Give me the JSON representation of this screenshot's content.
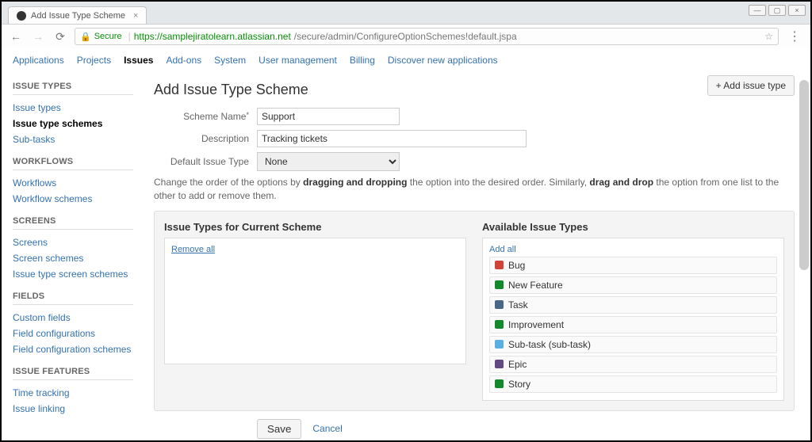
{
  "browser": {
    "tab_title": "Add Issue Type Scheme",
    "secure_label": "Secure",
    "url_host": "https://samplejiratolearn.atlassian.net",
    "url_path": "/secure/admin/ConfigureOptionSchemes!default.jspa"
  },
  "topnav": {
    "items": [
      "Applications",
      "Projects",
      "Issues",
      "Add-ons",
      "System",
      "User management",
      "Billing",
      "Discover new applications"
    ],
    "active": "Issues"
  },
  "sidebar": {
    "sections": [
      {
        "title": "ISSUE TYPES",
        "links": [
          "Issue types",
          "Issue type schemes",
          "Sub-tasks"
        ],
        "active": "Issue type schemes"
      },
      {
        "title": "WORKFLOWS",
        "links": [
          "Workflows",
          "Workflow schemes"
        ]
      },
      {
        "title": "SCREENS",
        "links": [
          "Screens",
          "Screen schemes",
          "Issue type screen schemes"
        ]
      },
      {
        "title": "FIELDS",
        "links": [
          "Custom fields",
          "Field configurations",
          "Field configuration schemes"
        ]
      },
      {
        "title": "ISSUE FEATURES",
        "links": [
          "Time tracking",
          "Issue linking"
        ]
      }
    ]
  },
  "page": {
    "title": "Add Issue Type Scheme",
    "add_button": "+ Add issue type",
    "labels": {
      "scheme_name": "Scheme Name",
      "description": "Description",
      "default_type": "Default Issue Type"
    },
    "values": {
      "scheme_name": "Support",
      "description": "Tracking tickets",
      "default_type": "None"
    },
    "help_pre": "Change the order of the options by ",
    "help_b1": "dragging and dropping",
    "help_mid": " the option into the desired order. Similarly, ",
    "help_b2": "drag and drop",
    "help_post": " the option from one list to the other to add or remove them.",
    "left_panel_title": "Issue Types for Current Scheme",
    "left_panel_link": "Remove all",
    "right_panel_title": "Available Issue Types",
    "right_panel_link": "Add all",
    "available_types": [
      {
        "label": "Bug",
        "color": "ic-red"
      },
      {
        "label": "New Feature",
        "color": "ic-green"
      },
      {
        "label": "Task",
        "color": "ic-blue"
      },
      {
        "label": "Improvement",
        "color": "ic-green"
      },
      {
        "label": "Sub-task (sub-task)",
        "color": "ic-teal"
      },
      {
        "label": "Epic",
        "color": "ic-purple"
      },
      {
        "label": "Story",
        "color": "ic-green"
      }
    ],
    "save": "Save",
    "cancel": "Cancel"
  }
}
